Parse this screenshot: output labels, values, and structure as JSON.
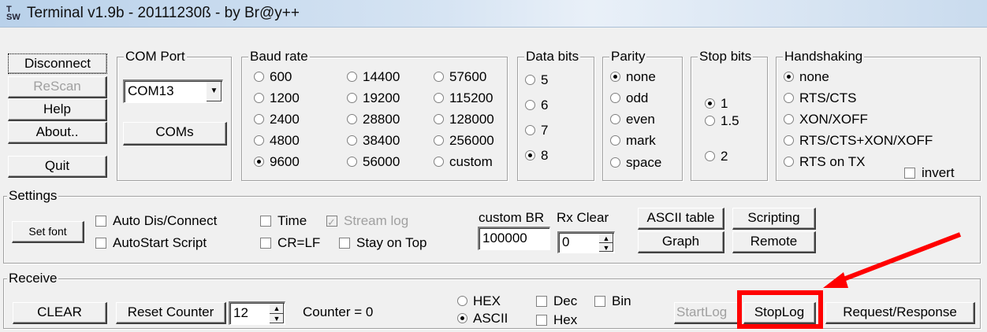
{
  "window": {
    "title": "Terminal v1.9b - 20111230ß - by Br@y++",
    "icon_text": "T SW"
  },
  "left_buttons": {
    "disconnect": "Disconnect",
    "rescan": "ReScan",
    "help": "Help",
    "about": "About..",
    "quit": "Quit"
  },
  "com_port": {
    "legend": "COM Port",
    "value": "COM13",
    "coms_button": "COMs"
  },
  "baud_rate": {
    "legend": "Baud rate",
    "options": [
      "600",
      "1200",
      "2400",
      "4800",
      "9600",
      "14400",
      "19200",
      "28800",
      "38400",
      "56000",
      "57600",
      "115200",
      "128000",
      "256000",
      "custom"
    ],
    "selected": "9600"
  },
  "data_bits": {
    "legend": "Data bits",
    "options": [
      "5",
      "6",
      "7",
      "8"
    ],
    "selected": "8"
  },
  "parity": {
    "legend": "Parity",
    "options": [
      "none",
      "odd",
      "even",
      "mark",
      "space"
    ],
    "selected": "none"
  },
  "stop_bits": {
    "legend": "Stop bits",
    "options": [
      "1",
      "1.5",
      "2"
    ],
    "selected": "1"
  },
  "handshaking": {
    "legend": "Handshaking",
    "options": [
      "none",
      "RTS/CTS",
      "XON/XOFF",
      "RTS/CTS+XON/XOFF",
      "RTS on TX"
    ],
    "selected": "none",
    "invert_label": "invert"
  },
  "settings": {
    "legend": "Settings",
    "set_font": "Set font",
    "auto_dis_connect": "Auto Dis/Connect",
    "autostart_script": "AutoStart Script",
    "time": "Time",
    "cr_lf": "CR=LF",
    "stream_log": "Stream log",
    "stay_on_top": "Stay on Top",
    "custom_br_label": "custom BR",
    "custom_br_value": "100000",
    "rx_clear_label": "Rx Clear",
    "rx_clear_value": "0",
    "ascii_table": "ASCII table",
    "scripting": "Scripting",
    "graph": "Graph",
    "remote": "Remote"
  },
  "receive": {
    "legend": "Receive",
    "clear": "CLEAR",
    "reset_counter": "Reset Counter",
    "counter_spin_value": "12",
    "counter_text": "Counter = 0",
    "hex": "HEX",
    "ascii": "ASCII",
    "selected_mode": "ASCII",
    "dec": "Dec",
    "bin": "Bin",
    "hex_check": "Hex",
    "startlog": "StartLog",
    "stoplog": "StopLog",
    "request_response": "Request/Response"
  },
  "annotation": {
    "highlight_color": "#ff0000"
  }
}
